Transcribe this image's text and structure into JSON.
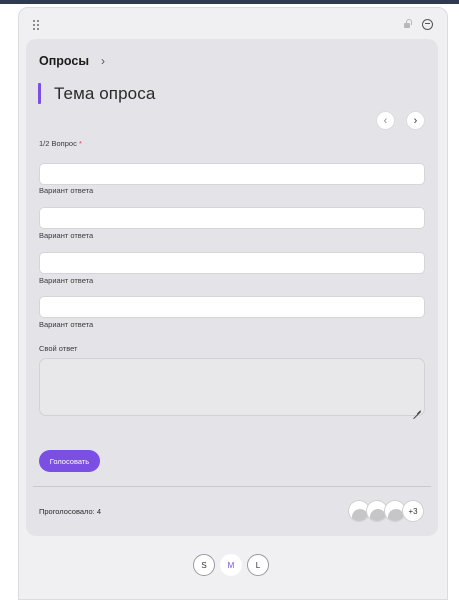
{
  "header": {
    "breadcrumb": "Опросы",
    "breadcrumb_chevron": "›",
    "title": "Тема опроса"
  },
  "nav": {
    "prev": "‹",
    "next": "›"
  },
  "question": {
    "label": "1/2 Вопрос",
    "required_mark": "*"
  },
  "options": [
    {
      "value": "",
      "caption": "Вариант ответа"
    },
    {
      "value": "",
      "caption": "Вариант ответа"
    },
    {
      "value": "",
      "caption": "Вариант ответа"
    },
    {
      "value": "",
      "caption": "Вариант ответа"
    }
  ],
  "own_answer": {
    "label": "Свой ответ",
    "value": ""
  },
  "vote_button": "Голосовать",
  "footer": {
    "voted_text": "Проголосовало: 4",
    "avatars_more": "+3"
  },
  "size_selector": {
    "options": [
      "S",
      "M",
      "L"
    ],
    "selected": "M"
  },
  "colors": {
    "accent": "#7b4fe3",
    "required": "#e0405a"
  },
  "icons": {
    "drag": "drag-handle-icon",
    "pin": "pin-icon",
    "minimize": "minus-circle-icon",
    "resize": "resize-grip-icon"
  }
}
